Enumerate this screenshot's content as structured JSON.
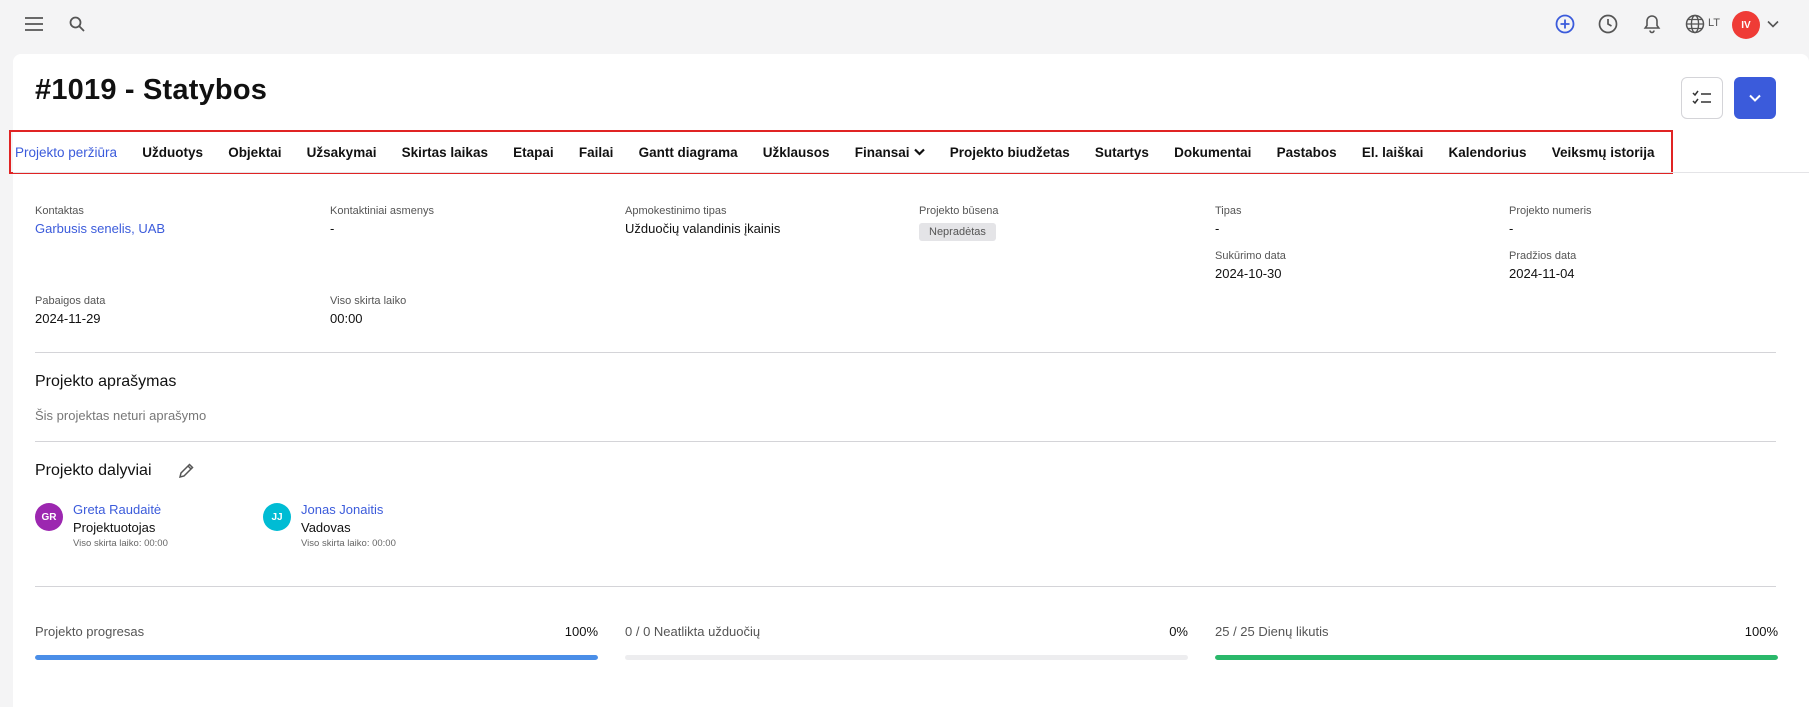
{
  "topbar": {
    "language": "LT",
    "user_initials": "IV",
    "user_color": "#ef3b36"
  },
  "header": {
    "title": "#1019 - Statybos"
  },
  "tabs": [
    {
      "label": "Projekto peržiūra"
    },
    {
      "label": "Užduotys"
    },
    {
      "label": "Objektai"
    },
    {
      "label": "Užsakymai"
    },
    {
      "label": "Skirtas laikas"
    },
    {
      "label": "Etapai"
    },
    {
      "label": "Failai"
    },
    {
      "label": "Gantt diagrama"
    },
    {
      "label": "Užklausos"
    },
    {
      "label": "Finansai"
    },
    {
      "label": "Projekto biudžetas"
    },
    {
      "label": "Sutartys"
    },
    {
      "label": "Dokumentai"
    },
    {
      "label": "Pastabos"
    },
    {
      "label": "El. laiškai"
    },
    {
      "label": "Kalendorius"
    },
    {
      "label": "Veiksmų istorija"
    }
  ],
  "fields": {
    "contact": {
      "label": "Kontaktas",
      "value": "Garbusis senelis, UAB"
    },
    "contact_persons": {
      "label": "Kontaktiniai asmenys",
      "value": "-"
    },
    "billing_type": {
      "label": "Apmokestinimo tipas",
      "value": "Užduočių valandinis įkainis"
    },
    "status": {
      "label": "Projekto būsena",
      "value": "Nepradėtas"
    },
    "type": {
      "label": "Tipas",
      "value": "-"
    },
    "project_number": {
      "label": "Projekto numeris",
      "value": "-"
    },
    "created_date": {
      "label": "Sukūrimo data",
      "value": "2024-10-30"
    },
    "start_date": {
      "label": "Pradžios data",
      "value": "2024-11-04"
    },
    "end_date": {
      "label": "Pabaigos data",
      "value": "2024-11-29"
    },
    "total_time": {
      "label": "Viso skirta laiko",
      "value": "00:00"
    }
  },
  "description": {
    "title": "Projekto aprašymas",
    "empty_text": "Šis projektas neturi aprašymo"
  },
  "participants": {
    "title": "Projekto dalyviai",
    "members": [
      {
        "initials": "GR",
        "name": "Greta Raudaitė",
        "role": "Projektuotojas",
        "time": "Viso skirta laiko: 00:00",
        "color": "#9c27b0"
      },
      {
        "initials": "JJ",
        "name": "Jonas Jonaitis",
        "role": "Vadovas",
        "time": "Viso skirta laiko: 00:00",
        "color": "#00bcd4"
      }
    ]
  },
  "progress": [
    {
      "label": "Projekto progresas",
      "value_text": "100%",
      "fraction": 1.0,
      "color": "#4a8ee8"
    },
    {
      "label": "0 / 0 Neatlikta užduočių",
      "value_text": "0%",
      "fraction": 0.0,
      "color": "#4a8ee8"
    },
    {
      "label": "25 / 25 Dienų likutis",
      "value_text": "100%",
      "fraction": 1.0,
      "color": "#2ab86a"
    }
  ]
}
